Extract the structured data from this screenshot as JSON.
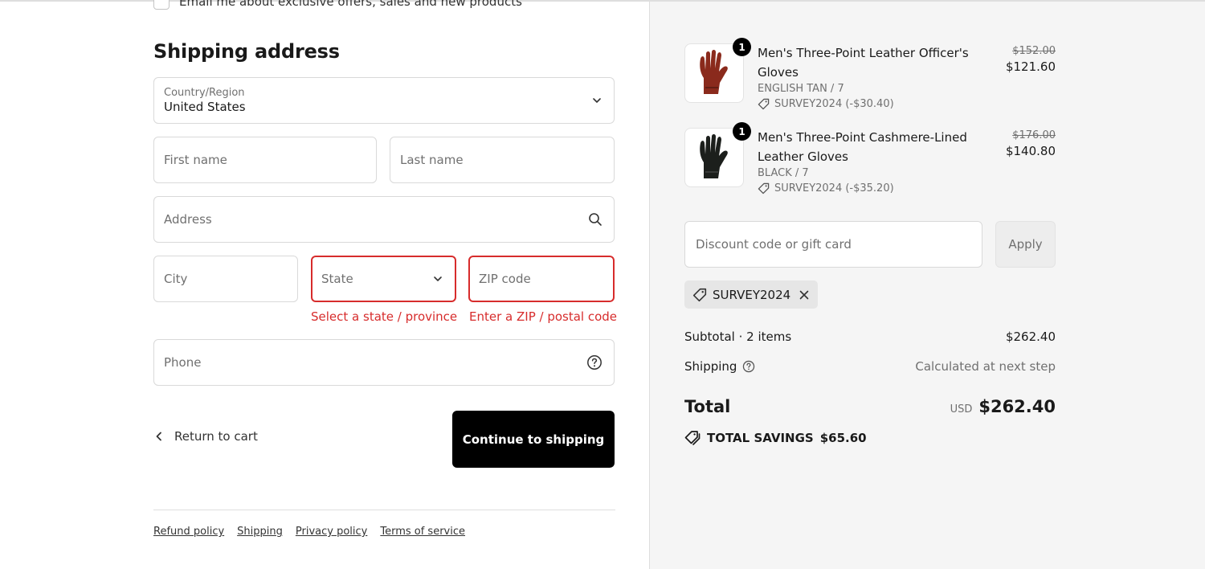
{
  "contact": {
    "email_optin_label": "Email me about exclusive offers, sales and new products"
  },
  "shipping": {
    "title": "Shipping address",
    "country": {
      "label": "Country/Region",
      "value": "United States"
    },
    "first_name_placeholder": "First name",
    "last_name_placeholder": "Last name",
    "address_placeholder": "Address",
    "city_placeholder": "City",
    "state": {
      "placeholder": "State",
      "error": "Select a state / province"
    },
    "zip": {
      "placeholder": "ZIP code",
      "error": "Enter a ZIP / postal code"
    },
    "phone_placeholder": "Phone"
  },
  "actions": {
    "return_label": "Return to cart",
    "continue_label": "Continue to shipping"
  },
  "footer": {
    "links": [
      "Refund policy",
      "Shipping",
      "Privacy policy",
      "Terms of service"
    ]
  },
  "cart": {
    "items": [
      {
        "name": "Men's Three-Point Leather Officer's Gloves",
        "variant": "ENGLISH TAN / 7",
        "discount": "SURVEY2024 (-$30.40)",
        "quantity": "1",
        "original_price": "$152.00",
        "price": "$121.60",
        "color": "#8a2a1c"
      },
      {
        "name": "Men's Three-Point Cashmere-Lined Leather Gloves",
        "variant": "BLACK / 7",
        "discount": "SURVEY2024 (-$35.20)",
        "quantity": "1",
        "original_price": "$176.00",
        "price": "$140.80",
        "color": "#1c1f1c"
      }
    ],
    "discount_placeholder": "Discount code or gift card",
    "apply_label": "Apply",
    "applied_code": "SURVEY2024",
    "subtotal_label": "Subtotal · 2 items",
    "subtotal_value": "$262.40",
    "shipping_label": "Shipping",
    "shipping_value": "Calculated at next step",
    "total_label": "Total",
    "currency": "USD",
    "total_value": "$262.40",
    "savings_label": "TOTAL SAVINGS",
    "savings_value": "$65.60"
  },
  "colors": {
    "error": "#d72c2c",
    "primary_button": "#000000",
    "summary_bg": "#f5f5f5"
  }
}
